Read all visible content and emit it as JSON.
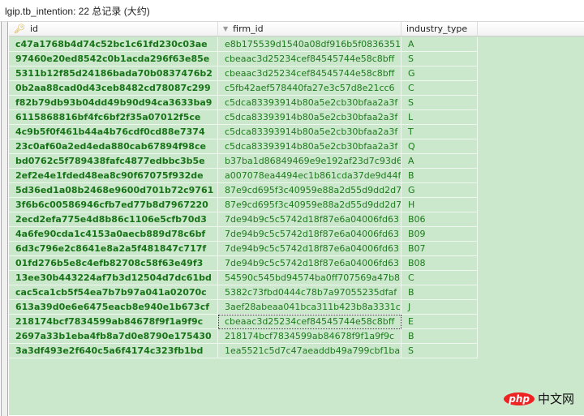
{
  "title": "lgip.tb_intention: 22 总记录 (大约)",
  "columns": [
    "id",
    "firm_id",
    "industry_type"
  ],
  "rows": [
    [
      "c47a1768b4d74c52bc1c61fd230c03ae",
      "e8b175539d1540a08df916b5f0836351",
      "A"
    ],
    [
      "97460e20ed8542c0b1acda296f63e85e",
      "cbeaac3d25234cef84545744e58c8bff",
      "S"
    ],
    [
      "5311b12f85d24186bada70b0837476b2",
      "cbeaac3d25234cef84545744e58c8bff",
      "G"
    ],
    [
      "0b2aa88cad0d43ceb8482cd78087c299",
      "c5fb42aef578440fa27e3c57d8e21cc6",
      "C"
    ],
    [
      "f82b79db93b04dd49b90d94ca3633ba9",
      "c5dca83393914b80a5e2cb30bfaa2a3f",
      "S"
    ],
    [
      "6115868816bf4fc6bf2f35a07012f5ce",
      "c5dca83393914b80a5e2cb30bfaa2a3f",
      "L"
    ],
    [
      "4c9b5f0f461b44a4b76cdf0cd88e7374",
      "c5dca83393914b80a5e2cb30bfaa2a3f",
      "T"
    ],
    [
      "23c0af60a2ed4eda880cab67894f98ce",
      "c5dca83393914b80a5e2cb30bfaa2a3f",
      "Q"
    ],
    [
      "bd0762c5f789438fafc4877edbbc3b5e",
      "b37ba1d86849469e9e192af23d7c93d6",
      "A"
    ],
    [
      "2ef2e4e1fded48ea8c90f67075f932de",
      "a007078ea4494ec1b861cda37de9d44f",
      "B"
    ],
    [
      "5d36ed1a08b2468e9600d701b72c9761",
      "87e9cd695f3c40959e88a2d55d9dd2d7",
      "G"
    ],
    [
      "3f6b6c00586946cfb7ed77b8d7967220",
      "87e9cd695f3c40959e88a2d55d9dd2d7",
      "H"
    ],
    [
      "2ecd2efa775e4d8b86c1106e5cfb70d3",
      "7de94b9c5c5742d18f87e6a04006fd63",
      "B06"
    ],
    [
      "4a6fe90cda1c4153a0aecb889d78c6bf",
      "7de94b9c5c5742d18f87e6a04006fd63",
      "B09"
    ],
    [
      "6d3c796e2c8641e8a2a5f481847c717f",
      "7de94b9c5c5742d18f87e6a04006fd63",
      "B07"
    ],
    [
      "01fd276b5e8c4efb82708c58f63e49f3",
      "7de94b9c5c5742d18f87e6a04006fd63",
      "B08"
    ],
    [
      "13ee30b443224af7b3d12504d7dc61bd",
      "54590c545bd94574ba0ff707569a47b8",
      "C"
    ],
    [
      "cac5ca1cb5f54ea7b7b97a041a02070c",
      "5382c73fbd0444c78b7a97055235dfaf",
      "B"
    ],
    [
      "613a39d0e6e6475eacb8e940e1b673cf",
      "3aef28abeaa041bca311b423b8a3331c",
      "J"
    ],
    [
      "218174bcf7834599ab84678f9f1a9f9c",
      "cbeaac3d25234cef84545744e58c8bff",
      "E"
    ],
    [
      "2697a33b1eba4fb8a7d0e8790e175430",
      "218174bcf7834599ab84678f9f1a9f9c",
      "B"
    ],
    [
      "3a3df493e2f640c5a6f4174c323fb1bd",
      "1ea5521c5d7c47aeaddb49a799cbf1ba",
      "S"
    ]
  ],
  "selected_row": 19,
  "watermark": "php中文网",
  "watermark_parts": [
    "php",
    "中文网"
  ]
}
